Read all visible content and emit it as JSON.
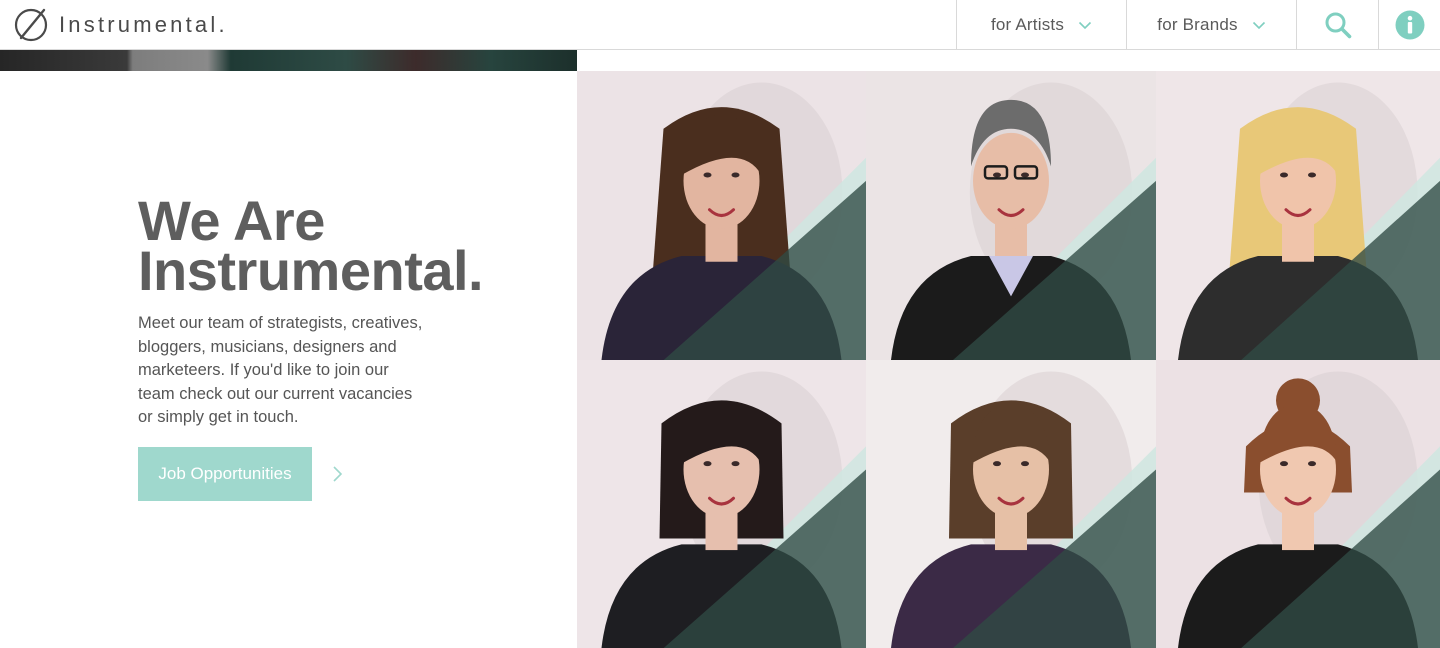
{
  "header": {
    "logo_text": "Instrumental.",
    "logo_icon": "circle-slash-icon",
    "nav": [
      {
        "label": "for Artists",
        "icon": "chevron-down-icon"
      },
      {
        "label": "for Brands",
        "icon": "chevron-down-icon"
      }
    ],
    "search_icon": "search-icon",
    "info_icon": "info-icon",
    "accent_color": "#7fcfc0"
  },
  "intro": {
    "title_line1": "We Are",
    "title_line2": "Instrumental.",
    "body": "Meet our team of strategists, creatives, bloggers, musicians, designers and marketeers. If you'd like to join our team check out our current vacancies or simply get in touch.",
    "cta_label": "Job Opportunities",
    "cta_icon": "chevron-right-icon",
    "cta_color": "#9fd8cd"
  },
  "team": {
    "overlay_color": "#2f4a44",
    "accent_stripe": "#cfe6e1",
    "members": [
      {
        "hair": "#4a2e1e",
        "top": "#2a2438",
        "skin": "#e2b5a0",
        "glasses": false,
        "hair_style": "long"
      },
      {
        "hair": "#6c6c6c",
        "top": "#1b1b1b",
        "skin": "#e7bda7",
        "glasses": true,
        "hair_style": "short"
      },
      {
        "hair": "#e8c878",
        "top": "#2d2d2d",
        "skin": "#f0c4aa",
        "glasses": false,
        "hair_style": "long"
      },
      {
        "hair": "#241a1a",
        "top": "#1e1e22",
        "skin": "#e6bfae",
        "glasses": false,
        "hair_style": "bob"
      },
      {
        "hair": "#5a3e2a",
        "top": "#3b2a46",
        "skin": "#e6c0a6",
        "glasses": false,
        "hair_style": "bob"
      },
      {
        "hair": "#8a4e2e",
        "top": "#1b1b1b",
        "skin": "#f0c8b0",
        "glasses": false,
        "hair_style": "bun"
      }
    ]
  }
}
